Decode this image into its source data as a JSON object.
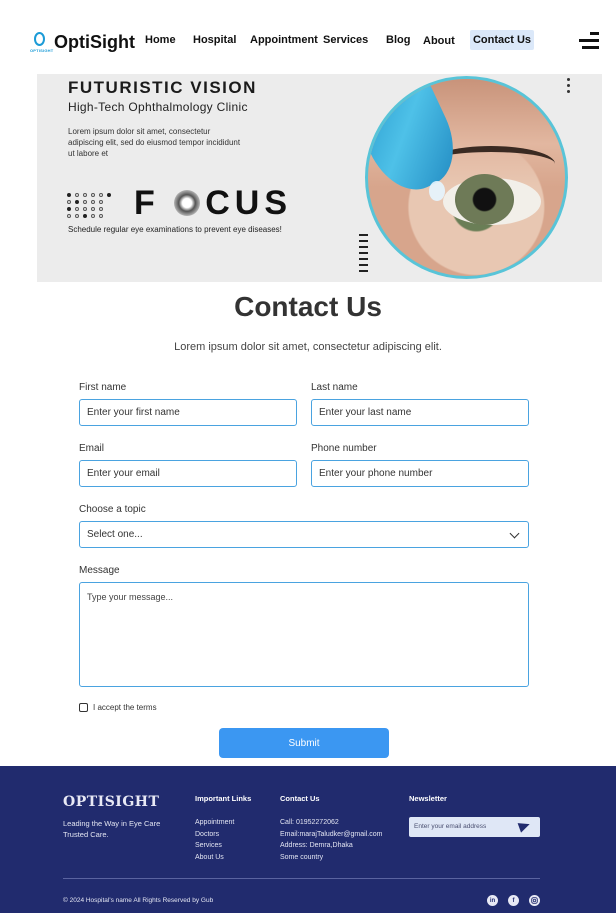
{
  "brand": {
    "name": "OptiSight",
    "tag": "OPTISIGHT",
    "accent": "#1b9bd7"
  },
  "nav": {
    "items": [
      "Home",
      "Hospital",
      "Appointment",
      "Services",
      "Blog",
      "About"
    ],
    "cta": "Contact Us",
    "menu_icon": "hamburger-menu-icon"
  },
  "hero": {
    "title": "FUTURISTIC VISION",
    "subtitle": "High-Tech Ophthalmology Clinic",
    "description": "Lorem ipsum dolor sit amet, consectetur adipiscing elit, sed do eiusmod tempor incididunt ut labore et",
    "focus_word_after_o": "CUS",
    "focus_word_before_o": "F",
    "tagline": "Schedule regular eye examinations to prevent eye diseases!"
  },
  "contact": {
    "title": "Contact Us",
    "subtitle": "Lorem ipsum dolor sit amet, consectetur adipiscing elit.",
    "first_name": {
      "label": "First name",
      "placeholder": "Enter your first name"
    },
    "last_name": {
      "label": "Last name",
      "placeholder": "Enter your last name"
    },
    "email": {
      "label": "Email",
      "placeholder": "Enter your email"
    },
    "phone": {
      "label": "Phone number",
      "placeholder": "Enter your phone number"
    },
    "topic": {
      "label": "Choose a topic",
      "selected": "Select one..."
    },
    "message": {
      "label": "Message",
      "placeholder": "Type your message..."
    },
    "terms": "I accept the terms",
    "submit": "Submit",
    "button_color": "#3b97f2"
  },
  "footer": {
    "brand": "OPTISIGHT",
    "tagline": "Leading the Way in Eye Care Trusted Care.",
    "links_heading": "Important Links",
    "links": [
      "Appointment",
      "Doctors",
      "Services",
      "About Us"
    ],
    "contact_heading": "Contact Us",
    "contact_lines": [
      "Call: 01952272062",
      "Email:marajTaludker@gmail.com",
      "Address: Demra,Dhaka",
      "Some country"
    ],
    "newsletter_heading": "Newsletter",
    "newsletter_placeholder": "Enter your email address",
    "copyright": "© 2024 Hospital's name All Rights Reserved by Gub",
    "social": [
      "in",
      "f",
      "ig"
    ],
    "bg_color": "#212b6e"
  }
}
